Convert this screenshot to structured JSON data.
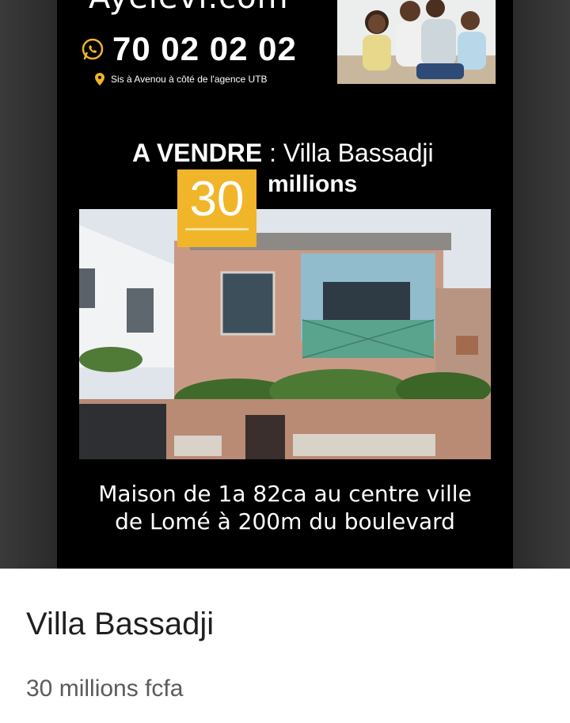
{
  "poster": {
    "brand": "Ayelevi.com",
    "phone": "70 02 02 02",
    "location": "Sis à Avenou à côté de l'agence UTB",
    "sale_prefix": "A VENDRE",
    "sale_separator": " : ",
    "sale_name": "Villa Bassadji",
    "price_number": "30",
    "price_unit": "millions",
    "description_line1": "Maison de 1a 82ca au centre ville",
    "description_line2": "de Lomé à 200m du boulevard",
    "accent_color": "#f1b52a",
    "icons": [
      "whatsapp-icon",
      "location-pin-icon"
    ]
  },
  "listing": {
    "title": "Villa Bassadji",
    "price": "30 millions fcfa"
  }
}
